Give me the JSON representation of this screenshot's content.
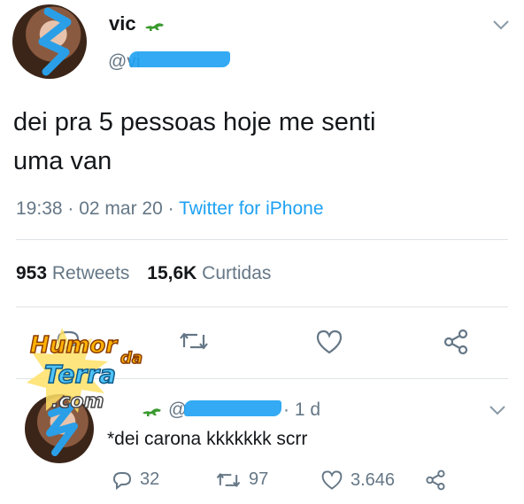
{
  "colors": {
    "accent": "#1da1f2",
    "muted": "#657786",
    "text": "#14171a",
    "divider": "#dfe3e6"
  },
  "tweet": {
    "display_name": "vic",
    "handle_prefix": "@vi",
    "text_line1": "dei pra 5 pessoas hoje me senti",
    "text_line2": "uma van",
    "time": "19:38",
    "date": "02 mar 20",
    "source": "Twitter for iPhone",
    "retweets_count": "953",
    "retweets_label": "Retweets",
    "likes_count": "15,6K",
    "likes_label": "Curtidas",
    "icons": [
      "reply-icon",
      "retweet-icon",
      "like-icon",
      "share-icon"
    ]
  },
  "watermark": {
    "line1": "Humor",
    "line2": "da",
    "line3": "Terra",
    "line4": ".com"
  },
  "reply": {
    "handle_prefix": "@",
    "age": "1 d",
    "text": "*dei carona kkkkkkk scrr",
    "reply_count": "32",
    "retweet_count": "97",
    "like_count": "3.646"
  }
}
